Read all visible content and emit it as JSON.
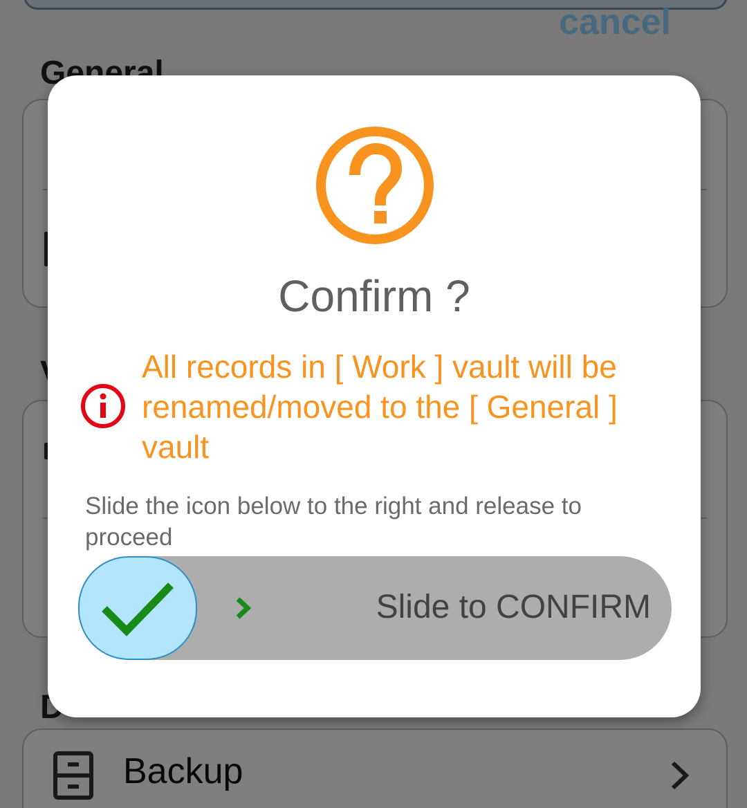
{
  "background": {
    "cancel_label": "cancel",
    "section_general": "General",
    "section_v": "V",
    "section_d": "D",
    "backup_label": "Backup",
    "backup_icon": "archive-drawer-icon",
    "backup_chevron_icon": "chevron-right-icon"
  },
  "dialog": {
    "icon": "question-circle-icon",
    "title": "Confirm ?",
    "warning_icon": "info-circle-icon",
    "warning_text": "All records in [ Work ] vault will be renamed/moved to the [ General ] vault",
    "hint_text": "Slide the icon below to the right and release to proceed",
    "slider": {
      "label": "Slide to CONFIRM",
      "handle_icon": "checkmark-icon",
      "arrow_icon": "chevron-right-icon",
      "progress": 0
    }
  },
  "colors": {
    "accent_orange": "#f7931e",
    "info_red": "#e30613",
    "handle_fill": "#b3e5fc",
    "check_green": "#188a18",
    "cancel_blue": "#8fd3ff"
  }
}
